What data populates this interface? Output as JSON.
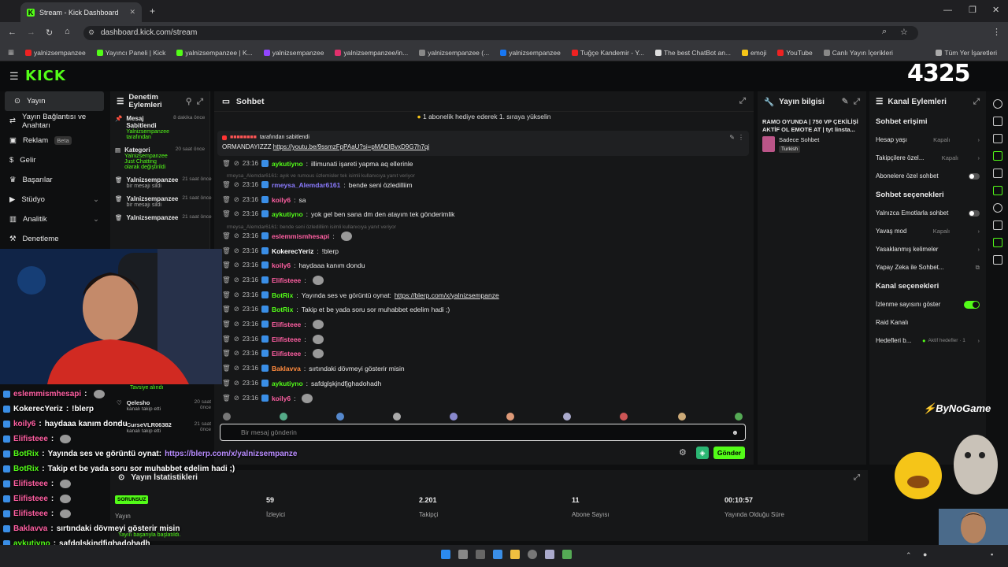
{
  "browser": {
    "tab_title": "Stream - Kick Dashboard",
    "url": "dashboard.kick.com/stream",
    "bookmarks": [
      "yalnizsempanzee",
      "Yayıncı Paneli | Kick",
      "yalnizsempanzee | K...",
      "yalnizsempanzee",
      "yalnizsempanzee/in...",
      "yalnizsempanzee (...",
      "yalnizsempanzee",
      "Tuğçe Kandemir - Y...",
      "The best ChatBot an...",
      "emoji",
      "YouTube",
      "Canlı Yayın İçerikleri"
    ],
    "bookmarks_all": "Tüm Yer İşaretleri"
  },
  "kick": {
    "logo": "KICK",
    "overlay_count": "4325"
  },
  "nav": [
    {
      "label": "Yayın",
      "active": true
    },
    {
      "label": "Yayın Bağlantısı ve Anahtarı"
    },
    {
      "label": "Reklam",
      "badge": "Beta"
    },
    {
      "label": "Gelir"
    },
    {
      "label": "Başarılar"
    },
    {
      "label": "Stüdyo",
      "chevron": true
    },
    {
      "label": "Analitik",
      "chevron": true
    },
    {
      "label": "Denetleme"
    }
  ],
  "mod": {
    "title": "Denetim Eylemleri",
    "items": [
      {
        "title": "Mesaj Sabitlendi",
        "sub": "Yalnizsempanzee tarafından",
        "time": "8 dakika önce"
      },
      {
        "title": "Kategori",
        "sub": "Yalnizsempanzee Just Chatting olarak değiştirildi",
        "time": "20 saat önce"
      },
      {
        "title": "Yalnizsempanzee",
        "sub": "bir mesajı sildi",
        "time": "21 saat önce"
      },
      {
        "title": "Yalnizsempanzee",
        "sub": "bir mesajı sildi",
        "time": "21 saat önce"
      },
      {
        "title": "Yalnizsempanzee",
        "sub": "",
        "time": "21 saat önce"
      }
    ],
    "lower": [
      {
        "title": "Tavsiye alındı",
        "time": ""
      },
      {
        "title": "Qelesho",
        "sub": "kanalı takip etti",
        "time": "20 saat önce"
      },
      {
        "title": "CurseVLR06382",
        "sub": "kanalı takip etti",
        "time": "21 saat önce"
      }
    ]
  },
  "chat": {
    "title": "Sohbet",
    "gift_banner": "1 abonelik hediye ederek 1. sıraya yükselin",
    "pinned_by": "tarafından sabitlendi",
    "pinned_text": "ORMANDAYIZZZ",
    "pinned_link": "https://youtu.be/9ssmzFpPAaU?si=pMADIBvxD9G7h7qj",
    "messages": [
      {
        "time": "23:16",
        "user": "aykutiyno",
        "color": "#53fc18",
        "text": "illimunati işareti yapma aq ellerinle"
      },
      {
        "time": "23:16",
        "user": "rmeysa_Alemdar6161",
        "color": "#8b7bff",
        "text": "bende seni özledilliim"
      },
      {
        "time": "23:16",
        "user": "koily6",
        "color": "#ff5fa2",
        "text": "sa"
      },
      {
        "time": "23:16",
        "user": "aykutiyno",
        "color": "#53fc18",
        "text": "yok gel ben sana dm den atayım tek gönderimlik"
      },
      {
        "time": "23:16",
        "user": "eslemmismhesapi",
        "color": "#ff5fa2",
        "text": ""
      },
      {
        "time": "23:16",
        "user": "KokerecYeriz",
        "color": "#ffffff",
        "text": "!blerp"
      },
      {
        "time": "23:16",
        "user": "koily6",
        "color": "#ff5fa2",
        "text": "haydaaa kanım dondu"
      },
      {
        "time": "23:16",
        "user": "Elifisteee",
        "color": "#ff5fa2",
        "text": ""
      },
      {
        "time": "23:16",
        "user": "BotRix",
        "color": "#53fc18",
        "text": "Yayında ses ve görüntü oynat:",
        "link": "https://blerp.com/x/yalnizsempanze"
      },
      {
        "time": "23:16",
        "user": "BotRix",
        "color": "#53fc18",
        "text": "Takip et be yada soru sor muhabbet edelim hadi ;)"
      },
      {
        "time": "23:16",
        "user": "Elifisteee",
        "color": "#ff5fa2",
        "text": ""
      },
      {
        "time": "23:16",
        "user": "Elifisteee",
        "color": "#ff5fa2",
        "text": ""
      },
      {
        "time": "23:16",
        "user": "Elifisteee",
        "color": "#ff5fa2",
        "text": ""
      },
      {
        "time": "23:16",
        "user": "Baklavva",
        "color": "#ff8a3d",
        "text": "sırtındaki dövmeyi gösterir misin"
      },
      {
        "time": "23:16",
        "user": "aykutiyno",
        "color": "#53fc18",
        "text": "safdglşkjndfjghadohadh"
      },
      {
        "time": "23:16",
        "user": "koily6",
        "color": "#ff5fa2",
        "text": ""
      }
    ],
    "sys1": "rmeysa_Alemdar6161: ayık ve rumous üzlemisler tek isimli kullanıcıya yanıt veriyor",
    "sys2": "rmeysa_Alemdar6161: bende seni özledilliim   isimli kullanıcıya yanıt veriyor",
    "placeholder": "Bir mesaj gönderin",
    "send": "Gönder"
  },
  "stream_info": {
    "title": "Yayın bilgisi",
    "stream_title": "RAMO OYUNDA | 750 VP ÇEKİLİŞİ AKTİF OL EMOTE AT | tyt linsta...",
    "category": "Sadece Sohbet",
    "lang": "Turkish"
  },
  "channel": {
    "title": "Kanal Eylemleri",
    "sec1": "Sohbet erişimi",
    "rows1": [
      {
        "label": "Hesap yaşı",
        "val": "Kapalı"
      },
      {
        "label": "Takipçilere özel...",
        "val": "Kapalı"
      },
      {
        "label": "Abonelere özel sohbet",
        "toggle": false
      }
    ],
    "sec2": "Sohbet seçenekleri",
    "rows2": [
      {
        "label": "Yalnızca Emotlarla sohbet",
        "toggle": false
      },
      {
        "label": "Yavaş mod",
        "val": "Kapalı"
      },
      {
        "label": "Yasaklanmış kelimeler",
        "val": ""
      },
      {
        "label": "Yapay Zeka ile Sohbet...",
        "val": ""
      }
    ],
    "sec3": "Kanal seçenekleri",
    "rows3": [
      {
        "label": "İzlenme sayısını göster",
        "toggle": true
      },
      {
        "label": "Raid Kanalı",
        "val": ""
      },
      {
        "label": "Hedefleri b...",
        "val": "Aktif hedefler · 1"
      }
    ]
  },
  "stats": {
    "title": "Yayın İstatistikleri",
    "status_badge": "SORUNSUZ",
    "status_label": "Yayın",
    "items": [
      {
        "value": "59",
        "label": "İzleyici"
      },
      {
        "value": "2.201",
        "label": "Takipçi"
      },
      {
        "value": "11",
        "label": "Abone Sayısı"
      },
      {
        "value": "00:10:57",
        "label": "Yayında Olduğu Süre"
      }
    ],
    "toast": "Yayın başarıyla başlatıldı."
  },
  "overlay": {
    "brand": "ByNoGame",
    "chat": [
      {
        "user": "eslemmismhesapi",
        "color": "#ff5fa2",
        "text": ""
      },
      {
        "user": "KokerecYeriz",
        "color": "#ffffff",
        "text": "!blerp"
      },
      {
        "user": "koily6",
        "color": "#ff5fa2",
        "text": "haydaaa kanım dondu"
      },
      {
        "user": "Elifisteee",
        "color": "#ff5fa2",
        "text": ""
      },
      {
        "user": "BotRix",
        "color": "#53fc18",
        "text": "Yayında ses ve görüntü oynat:",
        "link": "https://blerp.com/x/yalnizsempanze"
      },
      {
        "user": "BotRix",
        "color": "#53fc18",
        "text": "Takip et be yada soru sor muhabbet edelim hadi ;)"
      },
      {
        "user": "Elifisteee",
        "color": "#ff5fa2",
        "text": ""
      },
      {
        "user": "Elifisteee",
        "color": "#ff5fa2",
        "text": ""
      },
      {
        "user": "Elifisteee",
        "color": "#ff5fa2",
        "text": ""
      },
      {
        "user": "Baklavva",
        "color": "#ff5fa2",
        "text": "sırtındaki dövmeyi gösterir misin"
      },
      {
        "user": "aykutiyno",
        "color": "#53fc18",
        "text": "safdglşkjndfjghadohadh"
      },
      {
        "user": "koily6",
        "color": "#ff5fa2",
        "text": ""
      }
    ]
  },
  "colors": {
    "accent": "#53fc18",
    "panel": "#161718",
    "bg": "#0e0f10"
  }
}
